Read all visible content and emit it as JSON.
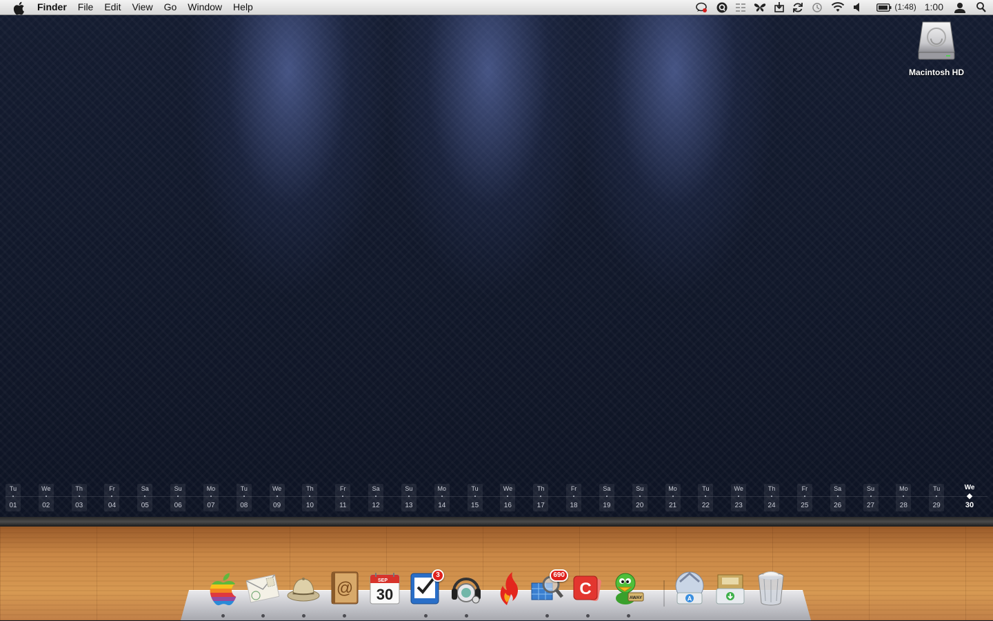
{
  "menubar": {
    "app_name": "Finder",
    "menus": [
      "File",
      "Edit",
      "View",
      "Go",
      "Window",
      "Help"
    ],
    "battery_time": "(1:48)",
    "clock": "1:00",
    "status_icons": [
      "messaging-icon",
      "q-icon",
      "list-icon",
      "butterfly-icon",
      "download-icon",
      "sync-icon",
      "time-machine-icon",
      "wifi-icon",
      "volume-icon",
      "battery-icon",
      "user-icon",
      "spotlight-icon"
    ]
  },
  "desktop": {
    "drive_label": "Macintosh HD"
  },
  "calendar": {
    "days": [
      {
        "dn": "Tu",
        "dd": "01"
      },
      {
        "dn": "We",
        "dd": "02"
      },
      {
        "dn": "Th",
        "dd": "03"
      },
      {
        "dn": "Fr",
        "dd": "04"
      },
      {
        "dn": "Sa",
        "dd": "05"
      },
      {
        "dn": "Su",
        "dd": "06"
      },
      {
        "dn": "Mo",
        "dd": "07"
      },
      {
        "dn": "Tu",
        "dd": "08"
      },
      {
        "dn": "We",
        "dd": "09"
      },
      {
        "dn": "Th",
        "dd": "10"
      },
      {
        "dn": "Fr",
        "dd": "11"
      },
      {
        "dn": "Sa",
        "dd": "12"
      },
      {
        "dn": "Su",
        "dd": "13"
      },
      {
        "dn": "Mo",
        "dd": "14"
      },
      {
        "dn": "Tu",
        "dd": "15"
      },
      {
        "dn": "We",
        "dd": "16"
      },
      {
        "dn": "Th",
        "dd": "17"
      },
      {
        "dn": "Fr",
        "dd": "18"
      },
      {
        "dn": "Sa",
        "dd": "19"
      },
      {
        "dn": "Su",
        "dd": "20"
      },
      {
        "dn": "Mo",
        "dd": "21"
      },
      {
        "dn": "Tu",
        "dd": "22"
      },
      {
        "dn": "We",
        "dd": "23"
      },
      {
        "dn": "Th",
        "dd": "24"
      },
      {
        "dn": "Fr",
        "dd": "25"
      },
      {
        "dn": "Sa",
        "dd": "26"
      },
      {
        "dn": "Su",
        "dd": "27"
      },
      {
        "dn": "Mo",
        "dd": "28"
      },
      {
        "dn": "Tu",
        "dd": "29"
      },
      {
        "dn": "We",
        "dd": "30"
      }
    ],
    "today_index": 29
  },
  "dock": {
    "items": [
      {
        "icon": "apple-rainbow-icon",
        "badge": "",
        "running": true
      },
      {
        "icon": "mail-stamp-icon",
        "badge": "",
        "running": true
      },
      {
        "icon": "safari-helmet-icon",
        "badge": "",
        "running": true
      },
      {
        "icon": "address-book-icon",
        "badge": "",
        "running": true
      },
      {
        "icon": "calendar-icon",
        "badge": "",
        "running": false,
        "cal_month": "SEP",
        "cal_day": "30"
      },
      {
        "icon": "tasks-check-icon",
        "badge": "3",
        "running": true
      },
      {
        "icon": "headphones-icon",
        "badge": "",
        "running": true
      },
      {
        "icon": "flame-arrow-icon",
        "badge": "",
        "running": false
      },
      {
        "icon": "network-magnifier-icon",
        "badge": "690",
        "running": true
      },
      {
        "icon": "red-c-icon",
        "badge": "",
        "running": true
      },
      {
        "icon": "adium-duck-icon",
        "badge": "",
        "running": true,
        "sign": "AWAY"
      },
      {
        "icon": "app-store-icon",
        "badge": "",
        "running": false
      },
      {
        "icon": "downloads-box-icon",
        "badge": "",
        "running": false
      },
      {
        "icon": "trash-icon",
        "badge": "",
        "running": false
      }
    ]
  }
}
